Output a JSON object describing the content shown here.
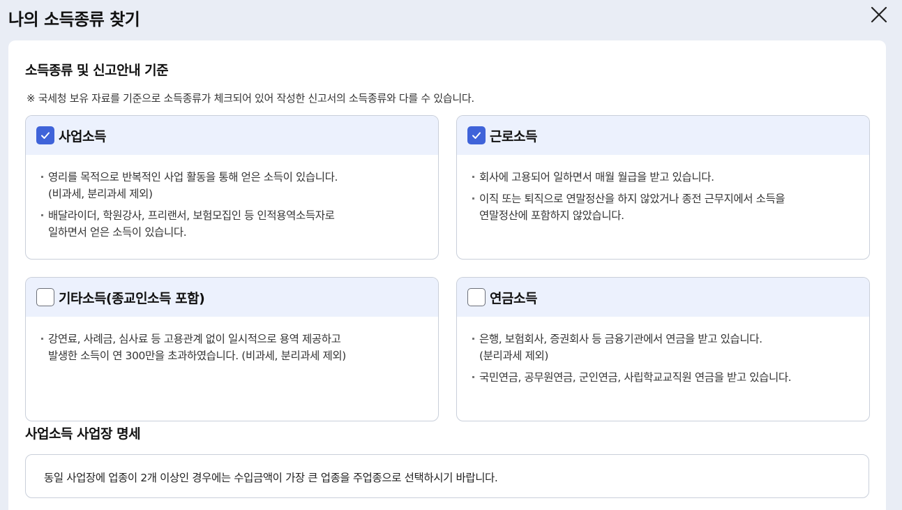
{
  "modal": {
    "title": "나의 소득종류 찾기",
    "close_icon": "close-icon"
  },
  "criteria": {
    "title": "소득종류 및 신고안내 기준",
    "notice": "※ 국세청 보유 자료를 기준으로 소득종류가 체크되어 있어 작성한 신고서의 소득종류와 다를 수 있습니다."
  },
  "cards": [
    {
      "title": "사업소득",
      "checked": true,
      "items": [
        [
          "영리를 목적으로 반복적인 사업 활동을 통해 얻은 소득이 있습니다.",
          "(비과세, 분리과세 제외)"
        ],
        [
          "배달라이더, 학원강사, 프리랜서, 보험모집인 등 인적용역소득자로",
          "일하면서 얻은 소득이 있습니다."
        ]
      ]
    },
    {
      "title": "근로소득",
      "checked": true,
      "items": [
        [
          "회사에 고용되어 일하면서 매월 월급을 받고 있습니다."
        ],
        [
          "이직 또는 퇴직으로 연말정산을 하지 않았거나 종전 근무지에서 소득을",
          "연말정산에 포함하지 않았습니다."
        ]
      ]
    },
    {
      "title": "기타소득(종교인소득 포함)",
      "checked": false,
      "items": [
        [
          "강연료, 사례금, 심사료 등 고용관계 없이 일시적으로 용역 제공하고",
          "발생한 소득이 연 300만을 초과하였습니다. (비과세, 분리과세 제외)"
        ]
      ]
    },
    {
      "title": "연금소득",
      "checked": false,
      "items": [
        [
          "은행, 보험회사, 증권회사 등 금융기관에서 연금을 받고 있습니다.",
          "(분리과세 제외)"
        ],
        [
          "국민연금, 공무원연금, 군인연금, 사립학교교직원 연금을 받고 있습니다."
        ]
      ]
    }
  ],
  "business_detail": {
    "title": "사업소득 사업장 명세",
    "text": "동일 사업장에 업종이 2개 이상인 경우에는 수입금액이 가장 큰 업종을 주업종으로 선택하시기 바랍니다."
  },
  "colors": {
    "accent": "#3f63d9",
    "card_header": "#ecf1fd",
    "background": "#e9edf5"
  }
}
